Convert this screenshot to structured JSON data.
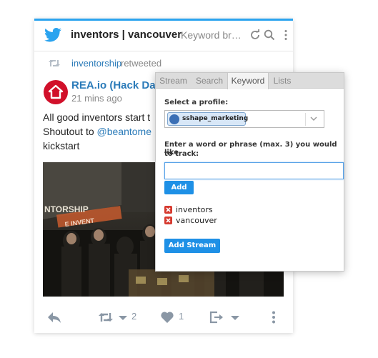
{
  "stream": {
    "title": "inventors | vancouver",
    "subtitle": "Keyword br…",
    "colors": {
      "accent": "#2aa3ef",
      "link": "#2b7bb9"
    }
  },
  "retweet_line": {
    "user": "inventorship",
    "verb": "retweeted"
  },
  "tweet": {
    "author": "REA.io (Hack Day)",
    "time": "21 mins ago",
    "line1": "All good inventors start t",
    "line2_prefix": "Shoutout to ",
    "line2_mention": "@beantome",
    "line3": "kickstart",
    "photo_sign_1": "NTORSHIP",
    "photo_sign_2": "E INVENT"
  },
  "actions": {
    "retweet_count": "2",
    "like_count": "1"
  },
  "popup": {
    "tabs": [
      "Stream",
      "Search",
      "Keyword",
      "Lists"
    ],
    "active_tab": "Keyword",
    "profile_label": "Select a profile:",
    "profile_value": "sshape_marketing",
    "track_label_1": "Enter a word or phrase (max. 3) you would like",
    "track_label_2": "to track:",
    "track_input_value": "",
    "add_label": "Add",
    "keywords": [
      "inventors",
      "vancouver"
    ],
    "add_stream_label": "Add Stream"
  }
}
